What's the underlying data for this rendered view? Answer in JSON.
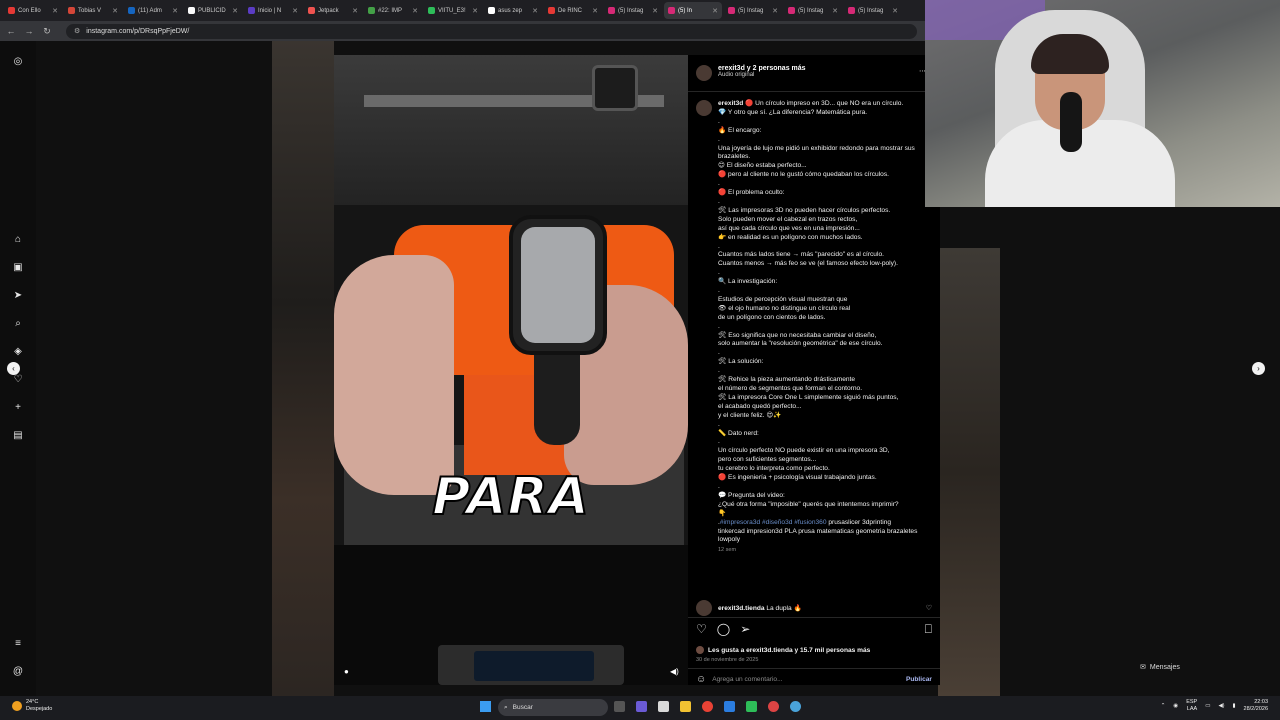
{
  "browser": {
    "tabs": [
      {
        "label": "Con Ello",
        "color": "#e53935",
        "active": false
      },
      {
        "label": "Tobias V",
        "color": "#d44638",
        "active": false
      },
      {
        "label": "(11) Adm",
        "color": "#1565c0",
        "active": false
      },
      {
        "label": "PUBLICID",
        "color": "#fafafa",
        "active": false
      },
      {
        "label": "Inicio | N",
        "color": "#5b3cc4",
        "active": false
      },
      {
        "label": "Jetpack",
        "color": "#ef5350",
        "active": false
      },
      {
        "label": "#22: IMP",
        "color": "#43a047",
        "active": false
      },
      {
        "label": "VIITU_E3!",
        "color": "#2ebd59",
        "active": false
      },
      {
        "label": "asus zep",
        "color": "#ffffff",
        "active": false
      },
      {
        "label": "De RINC",
        "color": "#e53935",
        "active": false
      },
      {
        "label": "(5) Instag",
        "color": "#d62976",
        "active": false
      },
      {
        "label": "(5) In",
        "color": "#d62976",
        "active": true
      },
      {
        "label": "(5) Instag",
        "color": "#d62976",
        "active": false
      },
      {
        "label": "(5) Instag",
        "color": "#d62976",
        "active": false
      },
      {
        "label": "(5) Instag",
        "color": "#d62976",
        "active": false
      }
    ],
    "url": "instagram.com/p/DRsqPpFjeDW/"
  },
  "post": {
    "author_line": "erexit3d y 2 personas más",
    "audio": "Audio original",
    "caption_overlay": "PARA",
    "author": "erexit3d",
    "caption_text": "🔴 Un círculo impreso en 3D... que NO era un círculo.\n💎 Y otro que sí. ¿La diferencia? Matemática pura.\n.\n🔥 El encargo:\n.\nUna joyería de lujo me pidió un exhibidor redondo para mostrar sus brazaletes.\n😊 El diseño estaba perfecto...\n🔴 pero al cliente no le gustó cómo quedaban los círculos.\n.\n🔴 El problema oculto:\n.\n🛠 Las impresoras 3D no pueden hacer círculos perfectos.\nSolo pueden mover el cabezal en trazos rectos,\nasí que cada círculo que ves en una impresión...\n👉 en realidad es un polígono con muchos lados.\n.\nCuantos más lados tiene → más \"parecido\" es al círculo.\nCuantos menos → más feo se ve (el famoso efecto low-poly).\n.\n🔍 La investigación:\n.\nEstudios de percepción visual muestran que\n👁 el ojo humano no distingue un círculo real\nde un polígono con cientos de lados.\n.\n🛠 Eso significa que no necesitaba cambiar el diseño,\nsolo aumentar la \"resolución geométrica\" de ese círculo.\n.\n🛠 La solución:\n.\n🛠 Rehice la pieza aumentando drásticamente\nel número de segmentos que forman el contorno.\n🛠 La impresora Core One L simplemente siguió más puntos,\nel acabado quedó perfecto...\ny el cliente feliz. 😍✨\n.\n📏 Dato nerd:\n.\nUn círculo perfecto NO puede existir en una impresora 3D,\npero con suficientes segmentos...\ntu cerebro lo interpreta como perfecto.\n🔴 Es ingeniería + psicología visual trabajando juntas.\n.\n💬 Pregunta del video:\n¿Qué otra forma \"imposible\" querés que intentemos imprimir?\n👇\n.",
    "hashtags": "#impresora3d #diseño3d #fusion360",
    "caption_tail": " prusaslicer 3dprinting tinkercad impresion3d PLA prusa matematicas geometria brazaletes lowpoly",
    "age": "12 sem",
    "comment_user": "erexit3d.tienda",
    "comment_text": " La dupla 🔥",
    "likes_text": "Les gusta a erexit3d.tienda y 15.7 mil personas más",
    "date": "30 de noviembre de 2025",
    "add_comment_placeholder": "Agrega un comentario...",
    "post_label": "Publicar",
    "prev_arrow": "‹",
    "next_arrow": "›"
  },
  "messages_label": "Mensajes",
  "taskbar": {
    "temp": "24°C",
    "weather": "Despejado",
    "search": "Buscar",
    "lang": "ESP",
    "lang2": "LAA",
    "time": "22:03",
    "date": "28/2/2026"
  }
}
